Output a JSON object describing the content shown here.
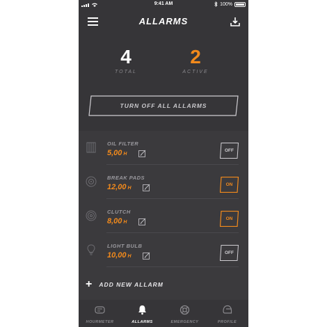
{
  "status_bar": {
    "time": "9:41 AM",
    "battery": "100%"
  },
  "header": {
    "title": "ALLARMS"
  },
  "stats": {
    "total": {
      "value": "4",
      "label": "TOTAL"
    },
    "active": {
      "value": "2",
      "label": "ACTIVE"
    }
  },
  "turn_off_all": {
    "label": "TURN OFF ALL ALLARMS"
  },
  "alarms": [
    {
      "name": "OIL FILTER",
      "value": "5,00",
      "unit": "H",
      "icon": "oil-filter-icon",
      "state": "OFF"
    },
    {
      "name": "BREAK PADS",
      "value": "12,00",
      "unit": "H",
      "icon": "brake-disc-icon",
      "state": "ON"
    },
    {
      "name": "CLUTCH",
      "value": "8,00",
      "unit": "H",
      "icon": "clutch-icon",
      "state": "ON"
    },
    {
      "name": "LIGHT BULB",
      "value": "10,00",
      "unit": "H",
      "icon": "light-bulb-icon",
      "state": "OFF"
    }
  ],
  "add_new": {
    "label": "ADD NEW ALLARM"
  },
  "tabs": [
    {
      "label": "HOURMETER",
      "icon": "hourmeter-icon",
      "active": false
    },
    {
      "label": "ALLARMS",
      "icon": "bell-icon",
      "active": true
    },
    {
      "label": "EMERGENCY",
      "icon": "lifebuoy-icon",
      "active": false
    },
    {
      "label": "PROFILE",
      "icon": "helmet-icon",
      "active": false
    }
  ],
  "colors": {
    "accent": "#f28a1c",
    "background": "#363538",
    "list_background": "#3b3a3d",
    "muted": "#8a898d"
  }
}
